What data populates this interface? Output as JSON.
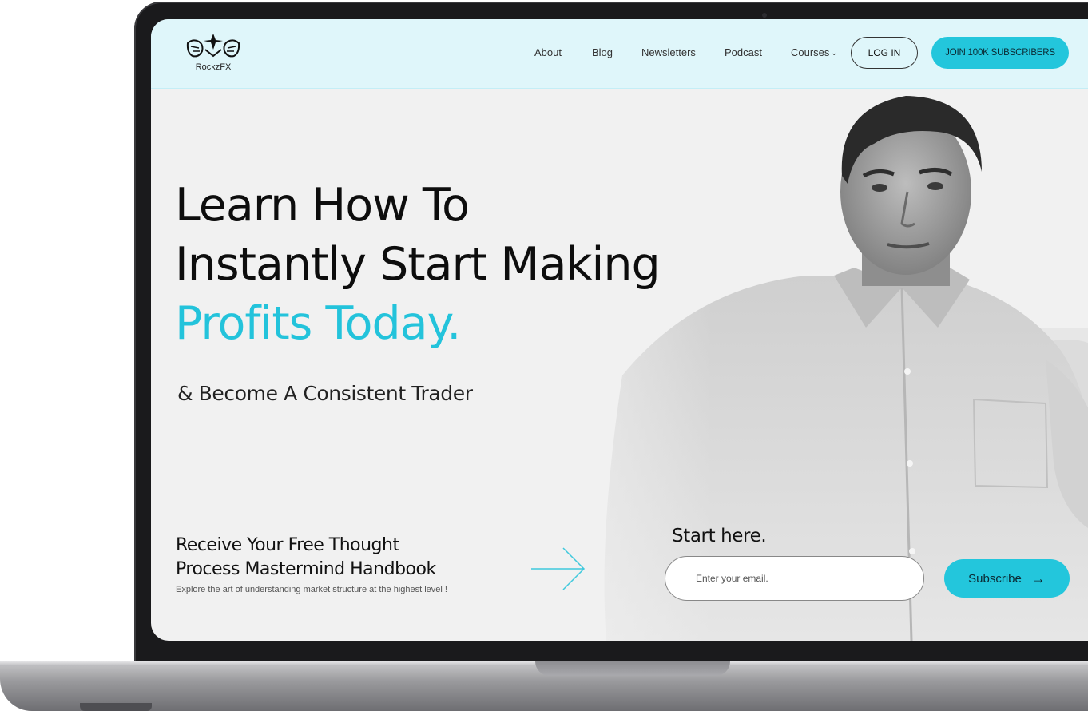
{
  "brand": {
    "name": "RockzFX"
  },
  "nav": {
    "items": [
      {
        "label": "About"
      },
      {
        "label": "Blog"
      },
      {
        "label": "Newsletters"
      },
      {
        "label": "Podcast"
      },
      {
        "label": "Courses"
      }
    ],
    "login_label": "LOG IN",
    "join_label": "JOIN 100K SUBSCRIBERS"
  },
  "hero": {
    "line1": "Learn How To",
    "line2": "Instantly Start Making",
    "line3_accent": "Profits Today.",
    "subline": "& Become A Consistent Trader"
  },
  "offer": {
    "title_line1": "Receive Your Free Thought",
    "title_line2": "Process Mastermind Handbook",
    "description": "Explore the art of understanding market structure at the highest level !"
  },
  "form": {
    "heading": "Start here.",
    "email_placeholder": "Enter your email.",
    "subscribe_label": "Subscribe"
  },
  "colors": {
    "accent": "#23c6dc",
    "header_bg": "#dff6fa",
    "text_dark": "#0d0d0d"
  },
  "icons": {
    "logo": "tiger-crest-icon",
    "nav_dropdown": "chevron-down-icon",
    "offer_pointer": "long-arrow-right-icon",
    "subscribe_arrow": "arrow-right-icon"
  }
}
